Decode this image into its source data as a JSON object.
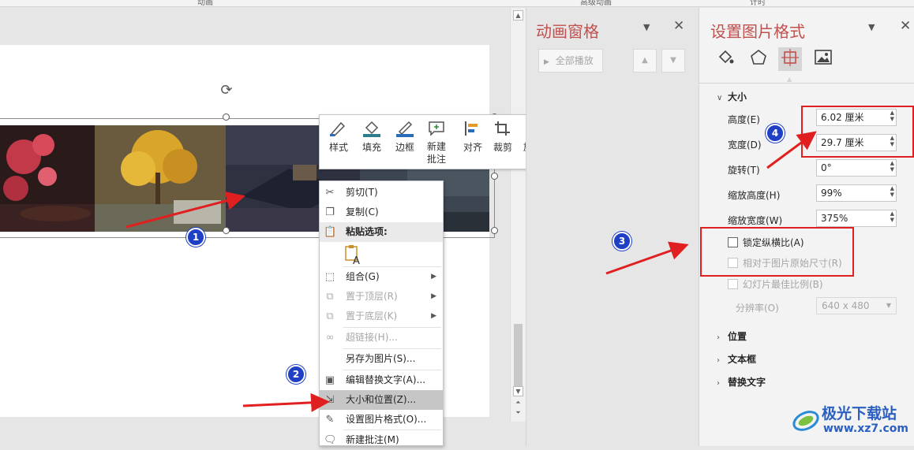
{
  "ribbon": {
    "labels": [
      "动画",
      "高级动画",
      "计时"
    ]
  },
  "toolbar": {
    "style": "样式",
    "fill": "填充",
    "border": "边框",
    "new_comment_l1": "新建",
    "new_comment_l2": "批注",
    "align": "对齐",
    "crop": "裁剪",
    "rotate": "旋转"
  },
  "menu": {
    "cut": "剪切(T)",
    "copy": "复制(C)",
    "paste_options": "粘贴选项:",
    "group": "组合(G)",
    "bring_front": "置于顶层(R)",
    "send_back": "置于底层(K)",
    "hyperlink": "超链接(H)...",
    "save_as_picture": "另存为图片(S)...",
    "edit_alt_text": "编辑替换文字(A)...",
    "size_position": "大小和位置(Z)...",
    "format_picture": "设置图片格式(O)...",
    "new_comment": "新建批注(M)"
  },
  "animation_pane": {
    "title": "动画窗格",
    "play_all": "全部播放"
  },
  "format_pane": {
    "title": "设置图片格式",
    "size_section": "大小",
    "height_label": "高度(E)",
    "height_value": "6.02 厘米",
    "width_label": "宽度(D)",
    "width_value": "29.7 厘米",
    "rotation_label": "旋转(T)",
    "rotation_value": "0°",
    "scale_height_label": "缩放高度(H)",
    "scale_height_value": "99%",
    "scale_width_label": "缩放宽度(W)",
    "scale_width_value": "375%",
    "lock_aspect": "锁定纵横比(A)",
    "relative_original": "相对于图片原始尺寸(R)",
    "best_scale": "幻灯片最佳比例(B)",
    "resolution_label": "分辨率(O)",
    "resolution_value": "640 x 480",
    "position_section": "位置",
    "textbox_section": "文本框",
    "alt_text_section": "替换文字"
  },
  "annotations": {
    "b1": "1",
    "b2": "2",
    "b3": "3",
    "b4": "4"
  },
  "watermark": {
    "name": "极光下载站",
    "url": "www.xz7.com"
  },
  "colors": {
    "accent": "#c0504d",
    "annotation_red": "#e02020",
    "badge_blue": "#1f3fc4"
  }
}
